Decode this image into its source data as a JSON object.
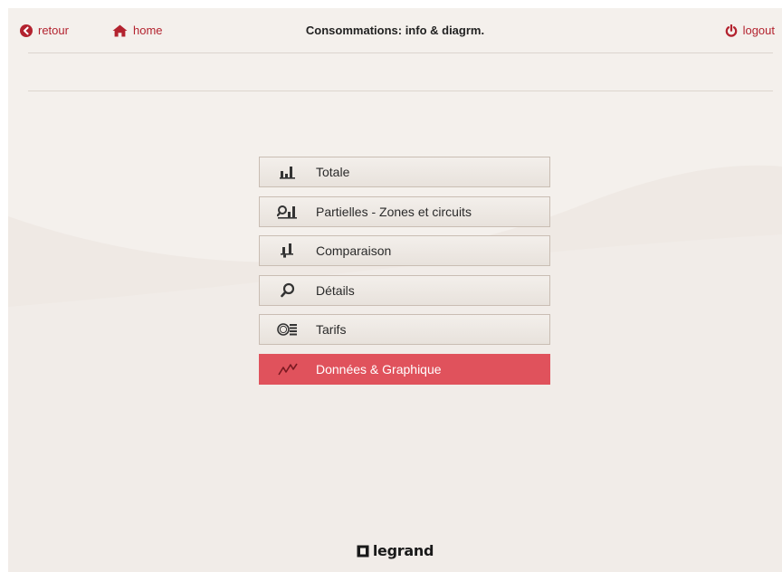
{
  "header": {
    "back_label": "retour",
    "home_label": "home",
    "title": "Consommations: info & diagrm.",
    "logout_label": "logout"
  },
  "colors": {
    "accent": "#b3232f",
    "active_item": "#e0525c",
    "background": "#f4f0ec"
  },
  "menu": {
    "items": [
      {
        "label": "Totale",
        "icon": "bar-chart-icon",
        "active": false
      },
      {
        "label": "Partielles - Zones et circuits",
        "icon": "zoom-chart-icon",
        "active": false
      },
      {
        "label": "Comparaison",
        "icon": "compare-chart-icon",
        "active": false
      },
      {
        "label": "Détails",
        "icon": "magnifier-icon",
        "active": false
      },
      {
        "label": "Tarifs",
        "icon": "coins-icon",
        "active": false
      },
      {
        "label": "Données & Graphique",
        "icon": "line-graph-icon",
        "active": true
      }
    ]
  },
  "footer": {
    "brand": "legrand"
  }
}
